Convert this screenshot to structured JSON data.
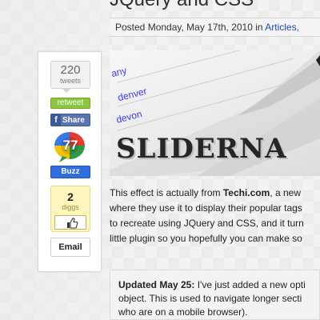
{
  "post": {
    "title": "JQuery and CSS",
    "meta_prefix": "Posted Monday, May 17th, 2010 in ",
    "meta_category": "Articles,"
  },
  "share": {
    "tweet_count": "220",
    "tweet_label": "tweets",
    "retweet_label": "retweet",
    "fb_letter": "f",
    "fb_share_label": "Share",
    "buzz_count": "77",
    "buzz_label": "Buzz",
    "digg_count": "2",
    "digg_label": "diggs",
    "email_label": "Email"
  },
  "feature_image": {
    "tags": [
      "any",
      "denver",
      "devon"
    ],
    "headline": "SLIDERNA"
  },
  "body": {
    "line1_prefix": "This effect is actually from ",
    "line1_link": "Techi.com",
    "line1_suffix": ", a new",
    "line2": "where they use it to display their popular tags",
    "line3": "to recreate using JQuery and CSS, and it turn",
    "line4": "little plugin so you hopefully you can make so"
  },
  "update": {
    "label": "Updated May 25:",
    "line1_rest": " I've just added a new opti",
    "line2": "object. This is used to navigate longer secti",
    "line3": "who are on a mobile browser)."
  },
  "colors": {
    "retweet_green": "#8cc640",
    "facebook_blue": "#3b5998",
    "buzz_blue": "#2f6de1",
    "digg_yellow": "#fff6bf",
    "link_blue": "#1f4aa8"
  },
  "icons": [
    "facebook-f-icon",
    "google-buzz-bubble-icon",
    "digg-thumbs-up-icon"
  ]
}
